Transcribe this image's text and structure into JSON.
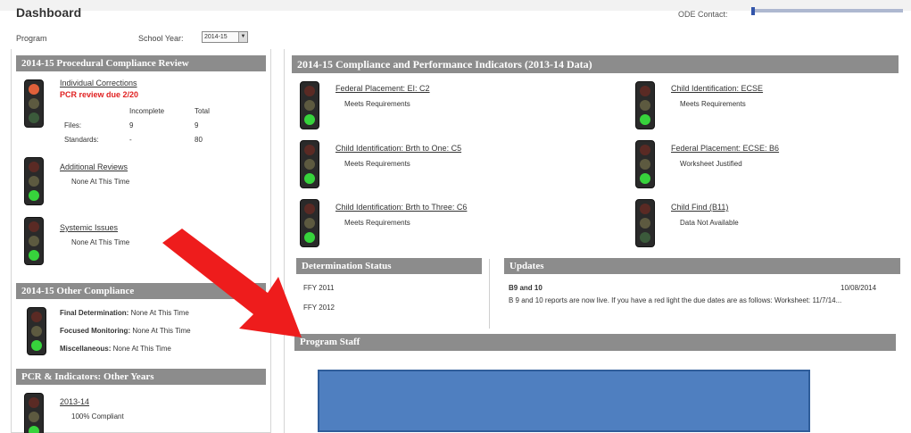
{
  "page": {
    "title": "Dashboard",
    "ode_contact_label": "ODE Contact:",
    "program_label": "Program",
    "school_year_label": "School Year:",
    "school_year_value": "2014-15"
  },
  "pcr": {
    "header": "2014-15 Procedural Compliance Review",
    "individual_link": "Individual Corrections",
    "due": "PCR review due 2/20",
    "col_incomplete": "Incomplete",
    "col_total": "Total",
    "files_label": "Files:",
    "files_incomplete": "9",
    "files_total": "9",
    "standards_label": "Standards:",
    "standards_incomplete": "-",
    "standards_total": "80",
    "additional_link": "Additional Reviews",
    "additional_status": "None At This Time",
    "systemic_link": "Systemic Issues",
    "systemic_status": "None At This Time"
  },
  "other_compliance": {
    "header": "2014-15 Other Compliance",
    "rows": [
      {
        "label": "Final Determination:",
        "value": "None At This Time"
      },
      {
        "label": "Focused Monitoring:",
        "value": "None At This Time"
      },
      {
        "label": "Miscellaneous:",
        "value": "None At This Time"
      }
    ]
  },
  "other_years": {
    "header": "PCR & Indicators: Other Years",
    "year_link": "2013-14",
    "year_status": "100% Compliant"
  },
  "indicators": {
    "header": "2014-15 Compliance and Performance Indicators (2013-14 Data)",
    "items": [
      {
        "title": "Federal Placement: EI: C2",
        "status": "Meets Requirements"
      },
      {
        "title": "Child Identification: ECSE",
        "status": "Meets Requirements"
      },
      {
        "title": "Child Identification: Brth to One: C5",
        "status": "Meets Requirements"
      },
      {
        "title": "Federal Placement: ECSE: B6",
        "status": "Worksheet Justified"
      },
      {
        "title": "Child Identification: Brth to Three: C6",
        "status": "Meets Requirements"
      },
      {
        "title": "Child Find (B11)",
        "status": "Data Not Available"
      }
    ]
  },
  "determination": {
    "header": "Determination Status",
    "items": [
      "FFY 2011",
      "FFY 2012"
    ]
  },
  "updates": {
    "header": "Updates",
    "item_title": "B9 and 10",
    "item_date": "10/08/2014",
    "item_text": "B 9 and 10 reports are now live. If you have a red light the due dates are as follows: Worksheet: 11/7/14..."
  },
  "staff": {
    "header": "Program Staff"
  },
  "colors": {
    "section_header": "#8c8c8c",
    "alert_red": "#e02020",
    "light_green": "#37d33c",
    "light_orange": "#e0603a",
    "arrow_red": "#ee1c1c",
    "staff_box": "#4f7fc0"
  }
}
